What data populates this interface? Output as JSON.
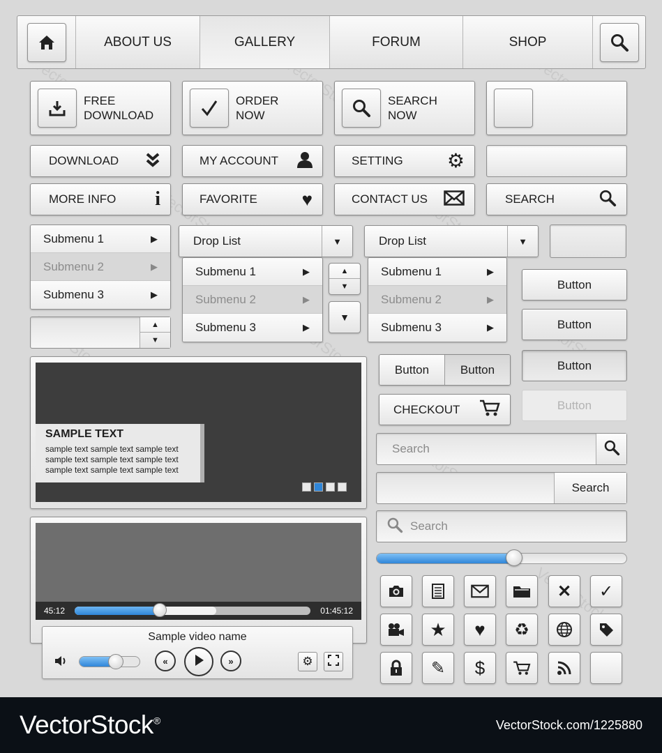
{
  "nav": {
    "items": [
      "ABOUT US",
      "GALLERY",
      "FORUM",
      "SHOP"
    ],
    "active": "GALLERY"
  },
  "big_buttons": [
    {
      "line1": "FREE",
      "line2": "DOWNLOAD",
      "icon": "download-icon"
    },
    {
      "line1": "ORDER",
      "line2": "NOW",
      "icon": "check-icon"
    },
    {
      "line1": "SEARCH",
      "line2": "NOW",
      "icon": "search-icon"
    }
  ],
  "small_buttons": {
    "download": "DOWNLOAD",
    "my_account": "MY ACCOUNT",
    "setting": "SETTING",
    "more_info": "MORE INFO",
    "favorite": "FAVORITE",
    "contact_us": "CONTACT US",
    "search": "SEARCH"
  },
  "submenu": [
    "Submenu 1",
    "Submenu 2",
    "Submenu 3"
  ],
  "dropdown": {
    "label": "Drop List"
  },
  "buttons": {
    "button": "Button",
    "checkout": "CHECKOUT"
  },
  "search": {
    "placeholder": "Search",
    "button": "Search"
  },
  "slider": {
    "value": 0.55,
    "accent": "#2f86d9"
  },
  "sample": {
    "title": "SAMPLE TEXT",
    "line": "sample text sample text sample text"
  },
  "video": {
    "current": "45:12",
    "total": "01:45:12",
    "name": "Sample video name",
    "progress": 0.36,
    "buffered": 0.6,
    "volume": 0.6
  },
  "icons": [
    "camera-icon",
    "notepad-icon",
    "mail-icon",
    "folder-icon",
    "close-icon",
    "check-icon",
    "video-camera-icon",
    "star-icon",
    "heart-icon",
    "recycle-icon",
    "globe-icon",
    "tag-icon",
    "lock-icon",
    "pencil-icon",
    "dollar-icon",
    "cart-icon",
    "rss-icon",
    "blank-icon"
  ],
  "footer": {
    "brand": "VectorStock",
    "registered": "®",
    "url": "VectorStock.com/1225880"
  }
}
